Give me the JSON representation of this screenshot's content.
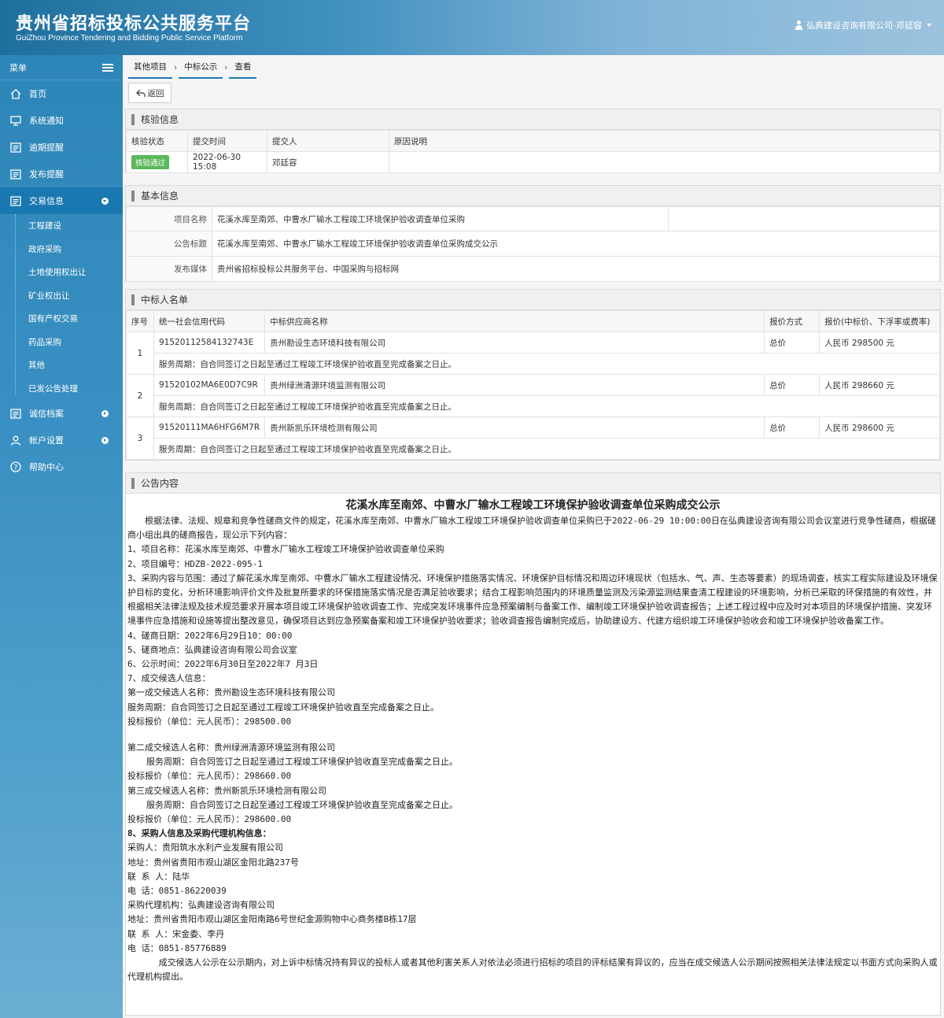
{
  "header": {
    "title": "贵州省招标投标公共服务平台",
    "subtitle": "GuiZhou Province Tendering and Bidding Public Service Platform",
    "user": "弘典建设咨询有限公司-邓廷容"
  },
  "sidebar": {
    "menu_label": "菜单",
    "items": [
      {
        "label": "首页"
      },
      {
        "label": "系统通知"
      },
      {
        "label": "逾期提醒"
      },
      {
        "label": "发布提醒"
      },
      {
        "label": "交易信息"
      },
      {
        "label": "诚信档案"
      },
      {
        "label": "帐户设置"
      },
      {
        "label": "帮助中心"
      }
    ],
    "sub_items": [
      "工程建设",
      "政府采购",
      "土地使用权出让",
      "矿业权出让",
      "国有产权交易",
      "药品采购",
      "其他",
      "已发公告处理"
    ]
  },
  "breadcrumb": [
    "其他项目",
    "中标公示",
    "查看"
  ],
  "back_button": "返回",
  "verify": {
    "title": "核验信息",
    "headers": [
      "核验状态",
      "提交时间",
      "提交人",
      "原因说明"
    ],
    "status": "核验通过",
    "time": "2022-06-30 15:08",
    "submitter": "邓廷容",
    "reason": ""
  },
  "basic": {
    "title": "基本信息",
    "rows": [
      {
        "label": "项目名称",
        "value": "花溪水库至南郊、中曹水厂输水工程竣工环境保护验收调查单位采购"
      },
      {
        "label": "公告标题",
        "value": "花溪水库至南郊、中曹水厂输水工程竣工环境保护验收调查单位采购成交公示"
      },
      {
        "label": "发布媒体",
        "value": "贵州省招标投标公共服务平台、中国采购与招标网"
      }
    ]
  },
  "winners": {
    "title": "中标人名单",
    "headers": [
      "序号",
      "统一社会信用代码",
      "中标供应商名称",
      "报价方式",
      "报价(中标价、下浮率或费率)"
    ],
    "rows": [
      {
        "no": "1",
        "code": "91520112584132743E",
        "name": "贵州勘设生态环境科技有限公司",
        "method": "总价",
        "price": "人民币 298500 元",
        "service": "服务周期：自合同签订之日起至通过工程竣工环境保护验收直至完成备案之日止。"
      },
      {
        "no": "2",
        "code": "91520102MA6E0D7C9R",
        "name": "贵州绿洲清源环境监测有限公司",
        "method": "总价",
        "price": "人民币 298660 元",
        "service": "服务周期：自合同签订之日起至通过工程竣工环境保护验收直至完成备案之日止。"
      },
      {
        "no": "3",
        "code": "91520111MA6HFG6M7R",
        "name": "贵州新凯乐环境检测有限公司",
        "method": "总价",
        "price": "人民币 298600 元",
        "service": "服务周期：自合同签订之日起至通过工程竣工环境保护验收直至完成备案之日止。"
      }
    ]
  },
  "notice": {
    "section_title": "公告内容",
    "title": "花溪水库至南郊、中曹水厂输水工程竣工环境保护验收调查单位采购成交公示",
    "intro": "根据法律、法规、规章和竞争性磋商文件的规定，花溪水库至南郊、中曹水厂输水工程竣工环境保护验收调查单位采购已于2022-06-29 10:00:00日在弘典建设咨询有限公司会议室进行竞争性磋商，根据磋商小组出具的磋商报告，现公示下列内容：",
    "item1": "1、项目名称：花溪水库至南郊、中曹水厂输水工程竣工环境保护验收调查单位采购",
    "item2": "2、项目编号：HDZB-2022-095-1",
    "item3": "3、采购内容与范围：通过了解花溪水库至南郊、中曹水厂输水工程建设情况、环境保护措施落实情况、环境保护目标情况和周边环境现状（包括水、气、声、生态等要素）的现场调查，核实工程实际建设及环境保护目标的变化，分析环境影响评价文件及批复所要求的环保措施落实情况是否满足验收要求；结合工程影响范围内的环境质量监测及污染源监测结果查清工程建设的环境影响，分析已采取的环保措施的有效性，并根据相关法律法规及技术规范要求开展本项目竣工环境保护验收调查工作、完成突发环境事件应急预案编制与备案工作、编制竣工环境保护验收调查报告；上述工程过程中应及时对本项目的环境保护措施、突发环境事件应急措施和设施等提出整改意见，确保项目达到应急预案备案和竣工环境保护验收要求；验收调查报告编制完成后，协助建设方、代建方组织竣工环境保护验收会和竣工环境保护验收备案工作。",
    "item4": "4、磋商日期：2022年6月29日10：00:00",
    "item5": "5、磋商地点：弘典建设咨询有限公司会议室",
    "item6": "6、公示时间：2022年6月30日至2022年7  月3日",
    "item7": "7、成交候选人信息：",
    "c1_name": "第一成交候选人名称：贵州勘设生态环境科技有限公司",
    "c1_service": "服务周期：自合同签订之日起至通过工程竣工环境保护验收直至完成备案之日止。",
    "c1_price": "投标报价（单位：元人民币）：298500.00",
    "c2_name": "第二成交候选人名称：贵州绿洲清源环境监测有限公司",
    "c2_service": "服务周期：自合同签订之日起至通过工程竣工环境保护验收直至完成备案之日止。",
    "c2_price": "投标报价（单位：元人民币）：298660.00",
    "c3_name": "第三成交候选人名称：贵州新凯乐环境检测有限公司",
    "c3_service": "服务周期：自合同签订之日起至通过工程竣工环境保护验收直至完成备案之日止。",
    "c3_price": "投标报价（单位：元人民币）：298600.00",
    "item8": "8、采购人信息及采购代理机构信息：",
    "buyer": "采购人：贵阳筑水水利产业发展有限公司",
    "buyer_addr": "地址：贵州省贵阳市观山湖区金阳北路237号",
    "buyer_contact": "联 系 人：陆华",
    "buyer_tel": "电 话：0851-86220039",
    "agent": "采购代理机构：弘典建设咨询有限公司",
    "agent_addr": "地址：贵州省贵阳市观山湖区金阳南路6号世纪金源购物中心商务楼B栋17层",
    "agent_contact": "联 系 人：宋金委、李丹",
    "agent_tel": "电 话：0851-85776889",
    "closing": "成交候选人公示在公示期内，对上诉中标情况持有异议的投标人或者其他利害关系人对依法必须进行招标的项目的评标结果有异议的，应当在成交候选人公示期间按照相关法律法规定以书面方式向采购人或代理机构提出。"
  }
}
